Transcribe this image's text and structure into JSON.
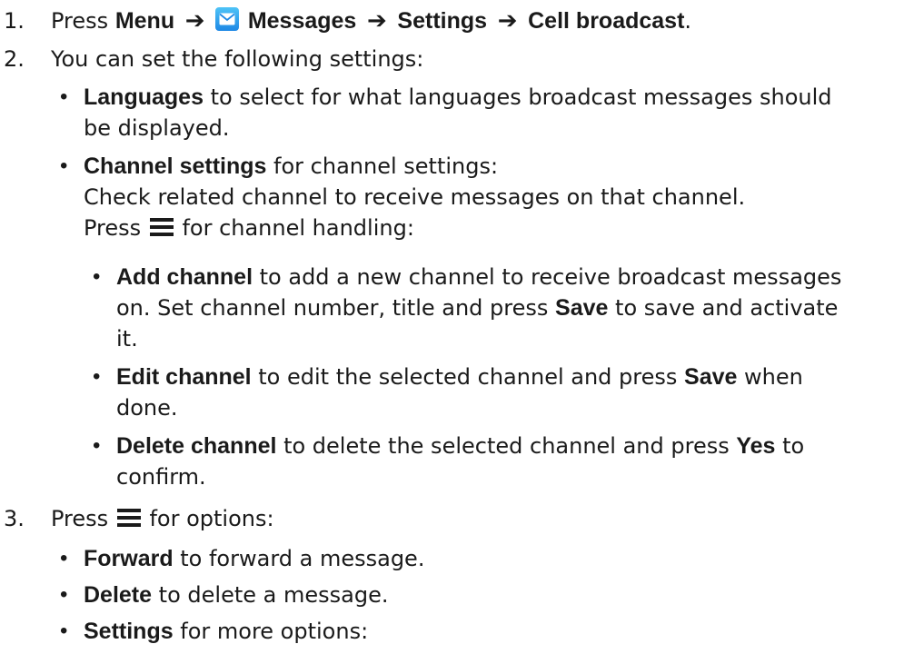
{
  "steps": [
    {
      "number": "1.",
      "press": "Press",
      "menu": "Menu",
      "messages": "Messages",
      "settings": "Settings",
      "cell_broadcast": "Cell broadcast",
      "end": "."
    },
    {
      "number": "2.",
      "text": "You can set the following settings:",
      "languages": {
        "term": "Languages",
        "rest_line1": " to select for what languages broadcast messages should",
        "line2": "be displayed."
      },
      "channel_settings": {
        "term": "Channel settings",
        "rest_line1": " for channel settings:",
        "line2": "Check related channel to receive messages on that channel.",
        "press": "Press",
        "press_rest": " for channel handling:",
        "add": {
          "term": "Add channel",
          "rest_line1": " to add a new channel to receive broadcast messages",
          "line2_a": "on. Set channel number, title and press ",
          "save": "Save",
          "line2_b": " to save and activate",
          "line3": "it."
        },
        "edit": {
          "term": "Edit channel",
          "rest_line1_a": " to edit the selected channel and press ",
          "save": "Save",
          "rest_line1_b": " when",
          "line2": "done."
        },
        "delete": {
          "term": "Delete channel",
          "rest_line1_a": " to delete the selected channel and press ",
          "yes": "Yes",
          "rest_line1_b": " to",
          "line2": "confirm."
        }
      }
    },
    {
      "number": "3.",
      "press": "Press",
      "rest": " for options:",
      "forward": {
        "term": "Forward",
        "rest": " to forward a message."
      },
      "delete": {
        "term": "Delete",
        "rest": " to delete a message."
      },
      "settings": {
        "term": "Settings",
        "rest": " for more options:"
      }
    }
  ],
  "bullet_char": "•",
  "icons": {
    "arrow": "right-arrow-icon",
    "messages": "envelope-icon",
    "menu": "hamburger-menu-icon"
  },
  "colors": {
    "messages_icon": "#2196f3",
    "text": "#1a1a1a"
  }
}
